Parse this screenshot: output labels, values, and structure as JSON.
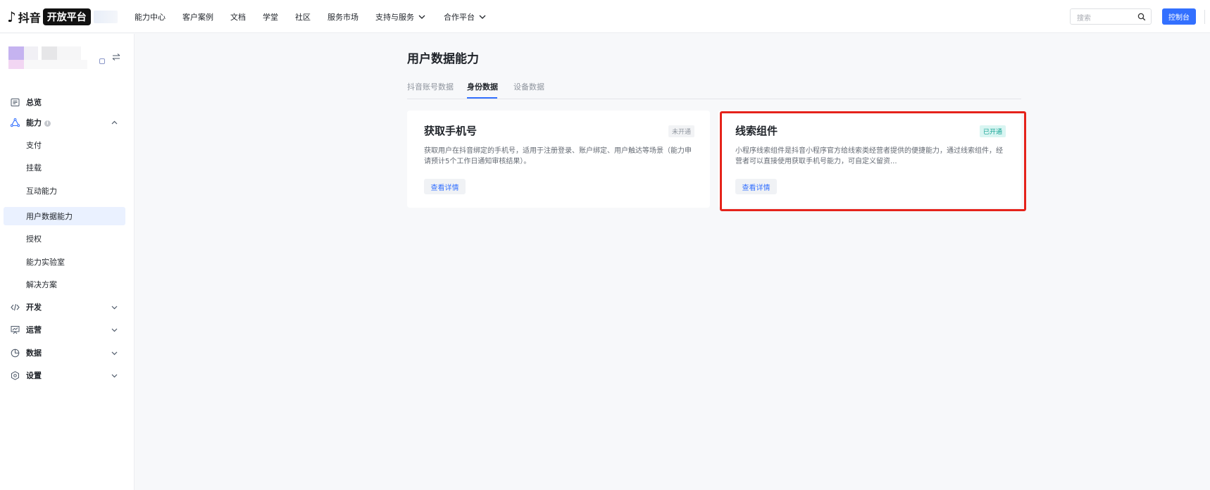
{
  "header": {
    "logo_brand": "抖音",
    "logo_badge": "开放平台",
    "nav": [
      {
        "label": "能力中心"
      },
      {
        "label": "客户案例"
      },
      {
        "label": "文档"
      },
      {
        "label": "学堂"
      },
      {
        "label": "社区"
      },
      {
        "label": "服务市场"
      },
      {
        "label": "支持与服务",
        "dropdown": true
      },
      {
        "label": "合作平台",
        "dropdown": true
      }
    ],
    "search_placeholder": "搜索",
    "console_label": "控制台"
  },
  "sidebar": {
    "items": [
      {
        "label": "总览",
        "icon": "overview-icon",
        "level": "top"
      },
      {
        "label": "能力",
        "icon": "capability-icon",
        "level": "top",
        "expanded": true,
        "info": "i"
      },
      {
        "label": "支付",
        "level": "sub"
      },
      {
        "label": "挂载",
        "level": "sub"
      },
      {
        "label": "互动能力",
        "level": "sub"
      },
      {
        "label": "用户数据能力",
        "level": "sub",
        "active": true
      },
      {
        "label": "授权",
        "level": "sub"
      },
      {
        "label": "能力实验室",
        "level": "sub"
      },
      {
        "label": "解决方案",
        "level": "sub"
      },
      {
        "label": "开发",
        "icon": "code-icon",
        "level": "top"
      },
      {
        "label": "运营",
        "icon": "operations-icon",
        "level": "top"
      },
      {
        "label": "数据",
        "icon": "pie-chart-icon",
        "level": "top"
      },
      {
        "label": "设置",
        "icon": "gear-icon",
        "level": "top"
      }
    ]
  },
  "main": {
    "title": "用户数据能力",
    "tabs": [
      {
        "label": "抖音账号数据"
      },
      {
        "label": "身份数据",
        "active": true
      },
      {
        "label": "设备数据"
      }
    ],
    "cards": [
      {
        "title": "获取手机号",
        "status": "未开通",
        "desc": "获取用户在抖音绑定的手机号，适用于注册登录、账户绑定、用户触达等场景（能力申请预计5个工作日通知审核结果）。",
        "button": "查看详情"
      },
      {
        "title": "线索组件",
        "status": "已开通",
        "desc": "小程序线索组件是抖音小程序官方给线索类经营者提供的便捷能力，通过线索组件，经营者可以直接使用获取手机号能力，可自定义留资...",
        "button": "查看详情"
      }
    ]
  },
  "colors": {
    "accent": "#3370ff",
    "active_bg": "#eaf1ff",
    "status_on": "#14a394",
    "highlight": "#e5231b"
  }
}
